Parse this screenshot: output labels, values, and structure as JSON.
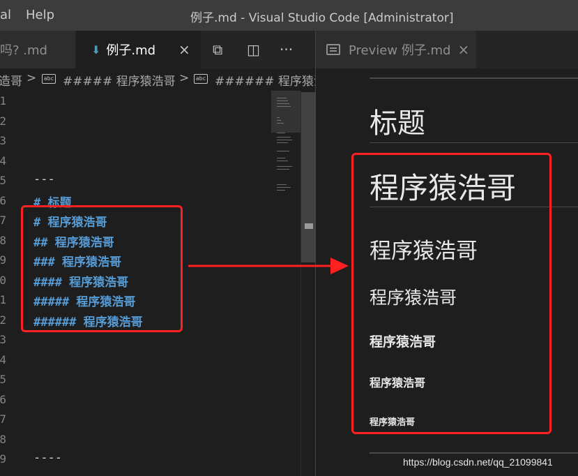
{
  "window": {
    "menu": [
      "al",
      "Help"
    ],
    "title": "例子.md - Visual Studio Code [Administrator]"
  },
  "tabs": {
    "left": [
      {
        "label": "吗? .md",
        "active": false
      },
      {
        "label": "例子.md",
        "active": true,
        "close": "×"
      }
    ],
    "actions": [
      "split-preview-icon",
      "split-editor-icon",
      "more-actions-icon"
    ],
    "actions_glyphs": [
      "⧉",
      "◫",
      "···"
    ],
    "right": [
      {
        "label": "Preview 例子.md",
        "close": "×"
      }
    ]
  },
  "breadcrumb": {
    "parts": [
      "造哥",
      "##### 程序猿浩哥",
      "###### 程序猿浩"
    ],
    "separator": ">",
    "abc_icon": "abc"
  },
  "editor": {
    "line_numbers": [
      "1",
      "2",
      "3",
      "4",
      "5",
      "6",
      "7",
      "8",
      "9",
      "0",
      "1",
      "2",
      "3",
      "4",
      "5",
      "6",
      "7",
      "8",
      "9"
    ],
    "lines": [
      {
        "text": "",
        "kind": "plain"
      },
      {
        "text": "",
        "kind": "plain"
      },
      {
        "text": "",
        "kind": "plain"
      },
      {
        "text": "",
        "kind": "plain"
      },
      {
        "text": "---",
        "kind": "plain"
      },
      {
        "text": "# 标题",
        "kind": "heading"
      },
      {
        "text": "# 程序猿浩哥",
        "kind": "heading"
      },
      {
        "text": "## 程序猿浩哥",
        "kind": "heading"
      },
      {
        "text": "### 程序猿浩哥",
        "kind": "heading"
      },
      {
        "text": "#### 程序猿浩哥",
        "kind": "heading"
      },
      {
        "text": "##### 程序猿浩哥",
        "kind": "heading"
      },
      {
        "text": "###### 程序猿浩哥",
        "kind": "heading"
      },
      {
        "text": "",
        "kind": "plain"
      },
      {
        "text": "",
        "kind": "plain"
      },
      {
        "text": "",
        "kind": "plain"
      },
      {
        "text": "",
        "kind": "plain"
      },
      {
        "text": "",
        "kind": "plain"
      },
      {
        "text": "",
        "kind": "plain"
      },
      {
        "text": "----",
        "kind": "plain"
      }
    ]
  },
  "preview": {
    "headings": [
      "标题",
      "程序猿浩哥",
      "程序猿浩哥",
      "程序猿浩哥",
      "程序猿浩哥",
      "程序猿浩哥",
      "程序猿浩哥"
    ]
  },
  "annotation": {
    "color": "#ff2020",
    "watermark": "https://blog.csdn.net/qq_21099841"
  }
}
